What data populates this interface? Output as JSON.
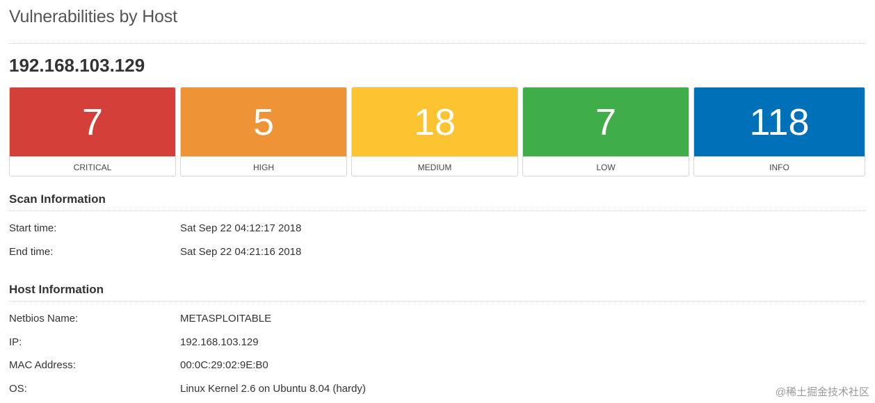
{
  "page": {
    "title": "Vulnerabilities by Host",
    "host": "192.168.103.129"
  },
  "severity": [
    {
      "label": "CRITICAL",
      "count": "7",
      "color": "#d43f3a"
    },
    {
      "label": "HIGH",
      "count": "5",
      "color": "#ee9336"
    },
    {
      "label": "MEDIUM",
      "count": "18",
      "color": "#fdc431"
    },
    {
      "label": "LOW",
      "count": "7",
      "color": "#3fae49"
    },
    {
      "label": "INFO",
      "count": "118",
      "color": "#0071b9"
    }
  ],
  "scan_info": {
    "title": "Scan Information",
    "rows": [
      {
        "key": "Start time:",
        "value": "Sat Sep 22 04:12:17 2018"
      },
      {
        "key": "End time:",
        "value": "Sat Sep 22 04:21:16 2018"
      }
    ]
  },
  "host_info": {
    "title": "Host Information",
    "rows": [
      {
        "key": "Netbios Name:",
        "value": "METASPLOITABLE"
      },
      {
        "key": "IP:",
        "value": "192.168.103.129"
      },
      {
        "key": "MAC Address:",
        "value": "00:0C:29:02:9E:B0"
      },
      {
        "key": "OS:",
        "value": "Linux Kernel 2.6 on Ubuntu 8.04 (hardy)"
      }
    ]
  },
  "watermark": "@稀土掘金技术社区"
}
